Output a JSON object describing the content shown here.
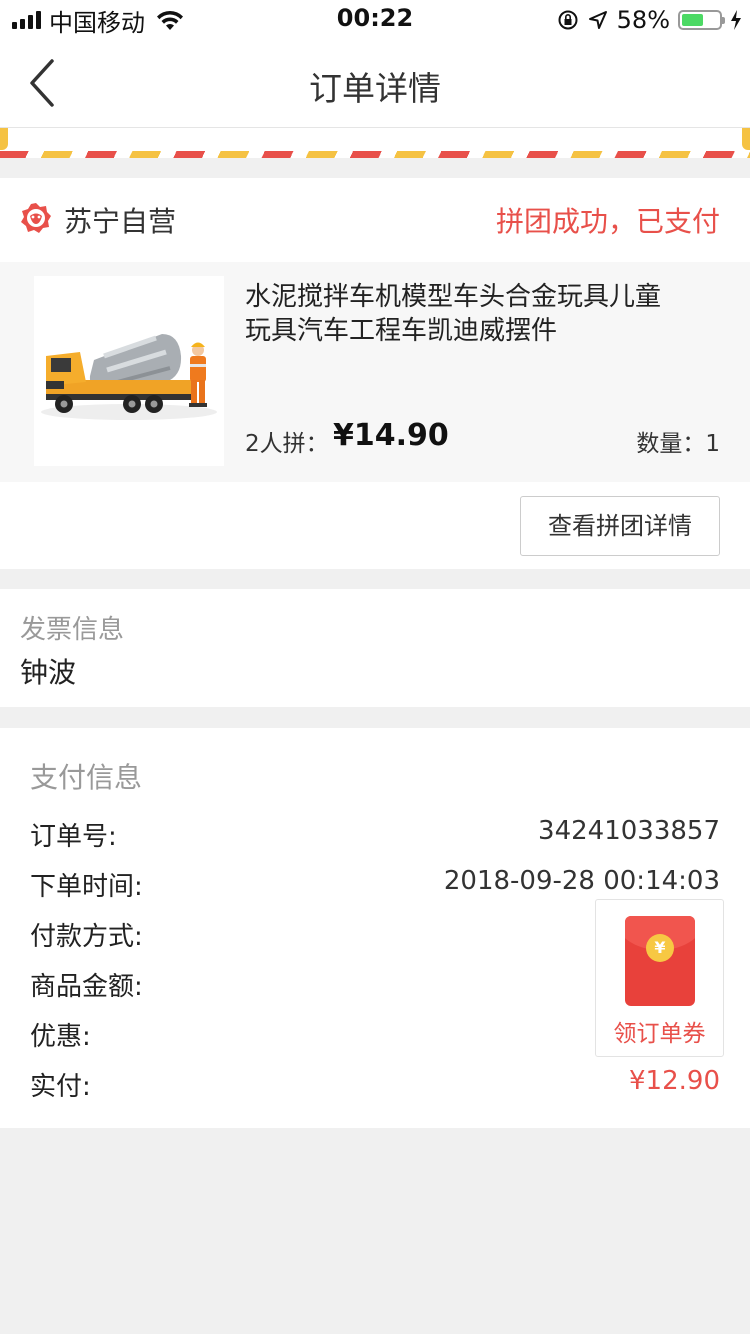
{
  "status_bar": {
    "carrier": "中国移动",
    "time": "00:22",
    "battery_pct": "58%",
    "battery_level": 0.58,
    "icons": [
      "signal-icon",
      "wifi-icon",
      "orientation-lock-icon",
      "location-icon",
      "battery-icon",
      "charging-icon"
    ]
  },
  "nav": {
    "title": "订单详情",
    "back_icon": "chevron-left-icon"
  },
  "order": {
    "shop": "苏宁自营",
    "status": "拼团成功，已支付",
    "product": {
      "title": "水泥搅拌车机模型车头合金玩具儿童玩具汽车工程车凯迪威摆件",
      "group_label": "2人拼：",
      "price": "¥14.90",
      "qty": "数量：1"
    },
    "group_button": "查看拼团详情"
  },
  "invoice": {
    "label": "发票信息",
    "value": "钟波"
  },
  "payment": {
    "title": "支付信息",
    "rows": [
      {
        "key": "订单号:",
        "value": "34241033857"
      },
      {
        "key": "下单时间:",
        "value": "2018-09-28 00:14:03"
      },
      {
        "key": "付款方式:",
        "value": ""
      },
      {
        "key": "商品金额:",
        "value": ""
      },
      {
        "key": "优惠:",
        "value": ""
      },
      {
        "key": "实付:",
        "value": "¥12.90"
      }
    ]
  },
  "coupon": {
    "label": "领订单券",
    "coin": "¥"
  },
  "colors": {
    "accent_red": "#e8504a",
    "stripe_yellow": "#f5c243",
    "battery_green": "#4cd964"
  }
}
